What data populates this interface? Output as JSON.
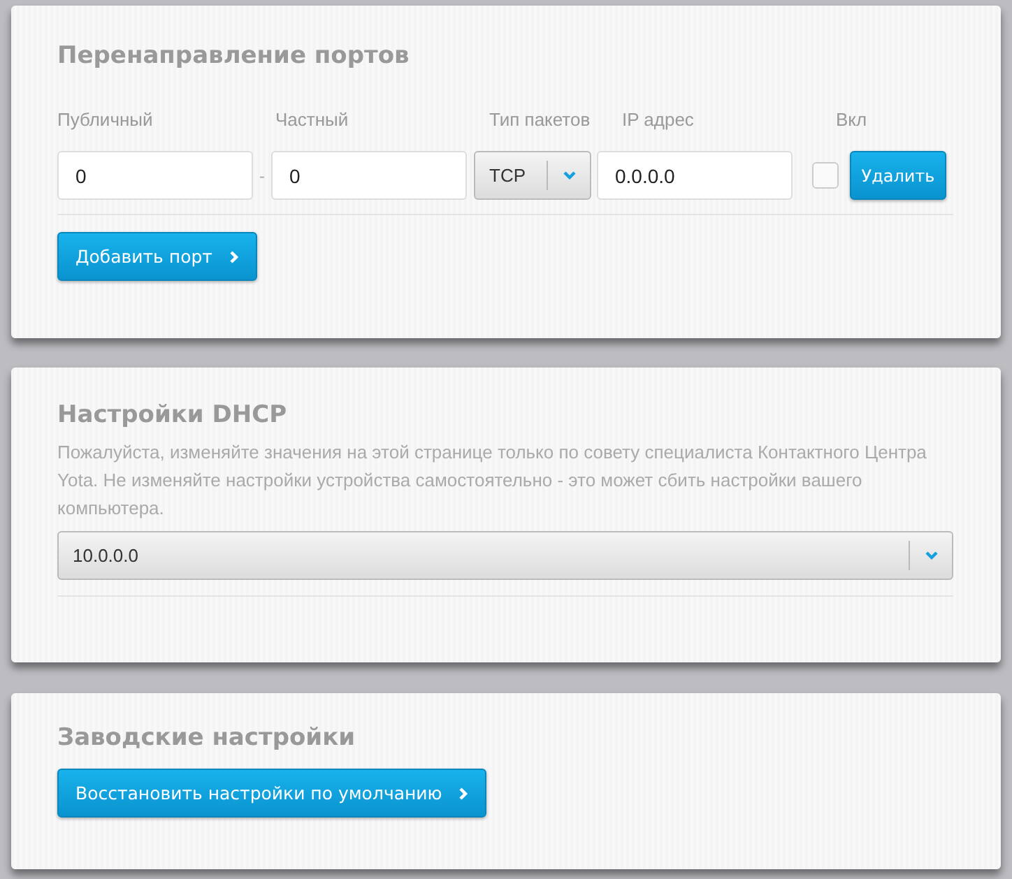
{
  "port_forwarding": {
    "title": "Перенаправление портов",
    "columns": [
      "Публичный",
      "Частный",
      "Тип пакетов",
      "IP адрес",
      "Вкл"
    ],
    "rows": [
      {
        "public": "0",
        "separator": "-",
        "private": "0",
        "protocol": "TCP",
        "ip": "0.0.0.0",
        "enabled": false,
        "delete_label": "Удалить"
      }
    ],
    "add_button": "Добавить порт"
  },
  "dhcp": {
    "title": "Настройки DHCP",
    "description": "Пожалуйста, изменяйте значения на этой странице только по совету специалиста Контактного Центра Yota. Не изменяйте настройки устройства самостоятельно - это может сбить настройки вашего компьютера.",
    "select_value": "10.0.0.0"
  },
  "factory": {
    "title": "Заводские настройки",
    "restore_button": "Восстановить настройки по умолчанию"
  }
}
